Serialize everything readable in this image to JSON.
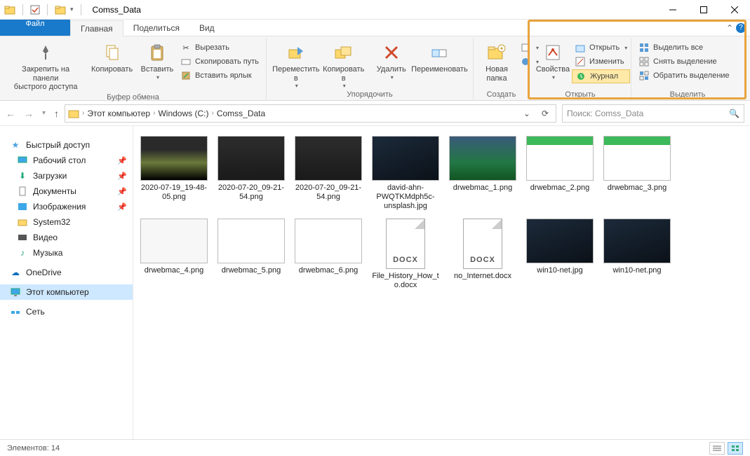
{
  "window": {
    "title": "Comss_Data"
  },
  "tabs": {
    "file": "Файл",
    "home": "Главная",
    "share": "Поделиться",
    "view": "Вид"
  },
  "ribbon": {
    "clipboard": {
      "label": "Буфер обмена",
      "pin1": "Закрепить на панели",
      "pin2": "быстрого доступа",
      "copy": "Копировать",
      "paste": "Вставить",
      "cut": "Вырезать",
      "copypath": "Скопировать путь",
      "shortcut": "Вставить ярлык"
    },
    "organize": {
      "label": "Упорядочить",
      "move1": "Переместить",
      "move2": "в",
      "copy1": "Копировать",
      "copy2": "в",
      "delete": "Удалить",
      "rename": "Переименовать"
    },
    "create": {
      "label": "Создать",
      "new1": "Новая",
      "new2": "папка"
    },
    "open": {
      "label": "Открыть",
      "props": "Свойства",
      "open": "Открыть",
      "edit": "Изменить",
      "history": "Журнал"
    },
    "select": {
      "label": "Выделить",
      "all": "Выделить все",
      "none": "Снять выделение",
      "invert": "Обратить выделение"
    }
  },
  "breadcrumb": {
    "pc": "Этот компьютер",
    "drive": "Windows (C:)",
    "folder": "Comss_Data"
  },
  "search": {
    "placeholder": "Поиск: Comss_Data"
  },
  "nav": {
    "quick": "Быстрый доступ",
    "desktop": "Рабочий стол",
    "downloads": "Загрузки",
    "documents": "Документы",
    "pictures": "Изображения",
    "system32": "System32",
    "video": "Видео",
    "music": "Музыка",
    "onedrive": "OneDrive",
    "thispc": "Этот компьютер",
    "network": "Сеть"
  },
  "files": [
    {
      "name": "2020-07-19_19-48-05.png",
      "thumb": "shot1"
    },
    {
      "name": "2020-07-20_09-21-54.png",
      "thumb": "shot2"
    },
    {
      "name": "2020-07-20_09-21-54.png",
      "thumb": "shot2"
    },
    {
      "name": "david-ahn-PWQTKMdph5c-unsplash.jpg",
      "thumb": "dark"
    },
    {
      "name": "drwebmac_1.png",
      "thumb": "photo"
    },
    {
      "name": "drwebmac_2.png",
      "thumb": "green"
    },
    {
      "name": "drwebmac_3.png",
      "thumb": "green"
    },
    {
      "name": "drwebmac_4.png",
      "thumb": "icons"
    },
    {
      "name": "drwebmac_5.png",
      "thumb": "paper"
    },
    {
      "name": "drwebmac_6.png",
      "thumb": "paper"
    },
    {
      "name": "File_History_How_to.docx",
      "thumb": "doc"
    },
    {
      "name": "no_Internet.docx",
      "thumb": "doc"
    },
    {
      "name": "win10-net.jpg",
      "thumb": "dark"
    },
    {
      "name": "win10-net.png",
      "thumb": "dark"
    }
  ],
  "status": {
    "count_label": "Элементов:",
    "count": "14"
  }
}
